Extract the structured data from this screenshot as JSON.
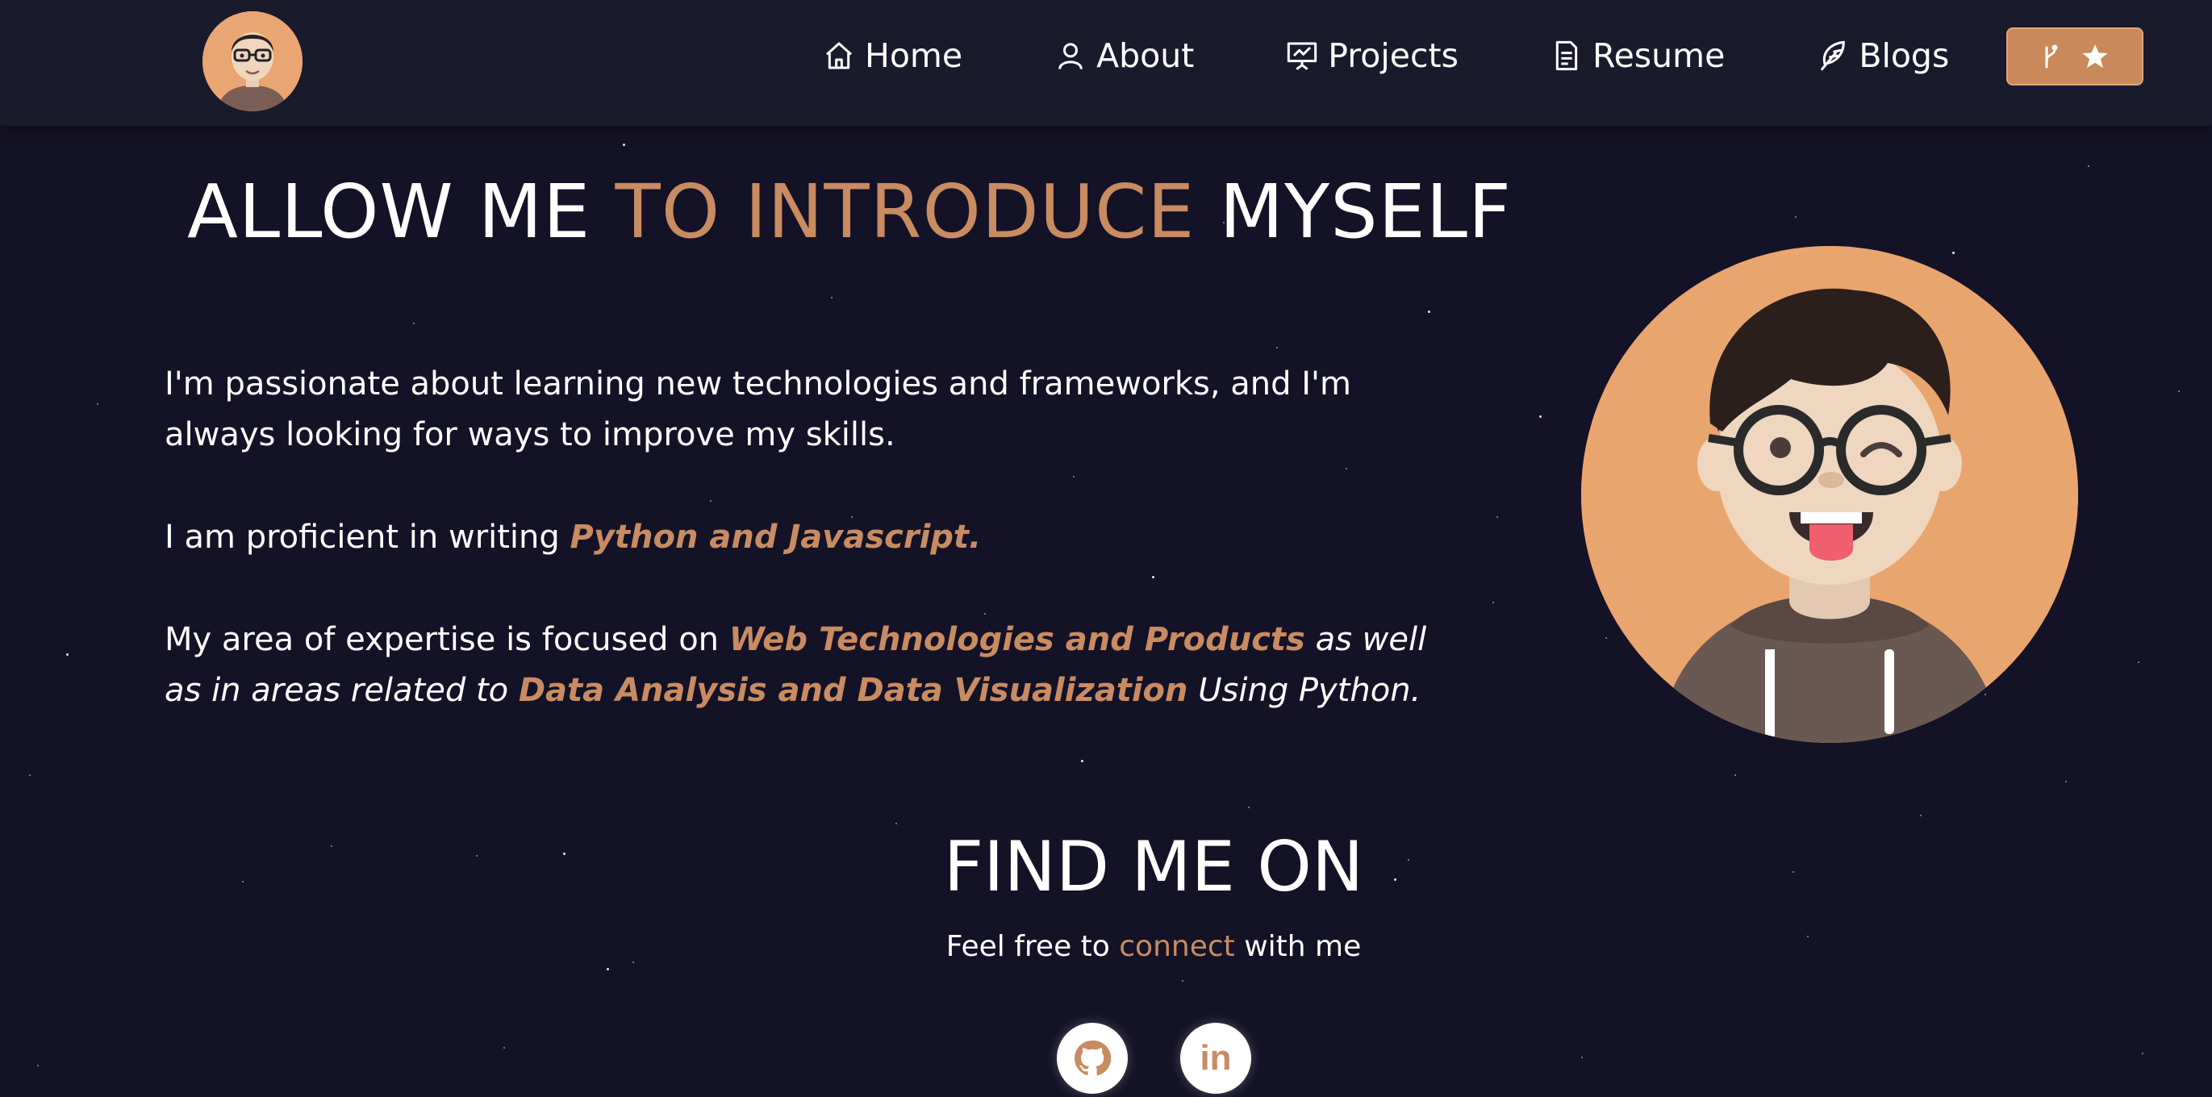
{
  "nav": {
    "items": [
      {
        "label": "Home",
        "icon": "home-icon"
      },
      {
        "label": "About",
        "icon": "user-icon"
      },
      {
        "label": "Projects",
        "icon": "presentation-icon"
      },
      {
        "label": "Resume",
        "icon": "document-icon"
      },
      {
        "label": "Blogs",
        "icon": "feather-icon"
      }
    ],
    "fork_button_icons": [
      "git-fork-icon",
      "star-icon"
    ]
  },
  "intro": {
    "title_part1": "ALLOW ME ",
    "title_accent": "TO INTRODUCE",
    "title_part2": " MYSELF",
    "para1": "I'm passionate about learning new technologies and frameworks, and I'm always looking for ways to improve my skills.",
    "para2_prefix": "I am proficient in writing ",
    "para2_accent": "Python and Javascript.",
    "para3_prefix": "My area of expertise is focused on ",
    "para3_accent1": "Web Technologies and Products",
    "para3_mid": " as well as in areas related to ",
    "para3_accent2": "Data Analysis and Data Visualization",
    "para3_suffix": " Using Python."
  },
  "find_me": {
    "title": "FIND ME ON",
    "subtitle_prefix": "Feel free to ",
    "subtitle_accent": "connect",
    "subtitle_suffix": " with me",
    "links": [
      {
        "name": "github",
        "icon": "github-icon"
      },
      {
        "name": "linkedin",
        "icon": "linkedin-icon",
        "glyph": "in"
      }
    ]
  },
  "colors": {
    "background": "#141226",
    "navbar": "#191a2c",
    "accent": "#c98b62",
    "button": "#c9895a",
    "avatar_bg": "#e9a56e"
  }
}
